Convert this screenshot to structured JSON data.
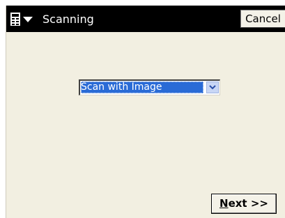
{
  "window": {
    "title": "Scanning",
    "menu_icon": "menu-list-icon",
    "menu_dropdown_icon": "triangle-down-icon"
  },
  "toolbar": {
    "cancel_label": "Cancel"
  },
  "scan_mode": {
    "selected": "Scan with Image",
    "dropdown_icon": "chevron-down-icon"
  },
  "footer": {
    "next_mnemonic": "N",
    "next_rest": "ext >>"
  },
  "colors": {
    "titlebar": "#000000",
    "background": "#f2efe1",
    "selection": "#2a6bd6",
    "button_face": "#f4f2e8"
  }
}
